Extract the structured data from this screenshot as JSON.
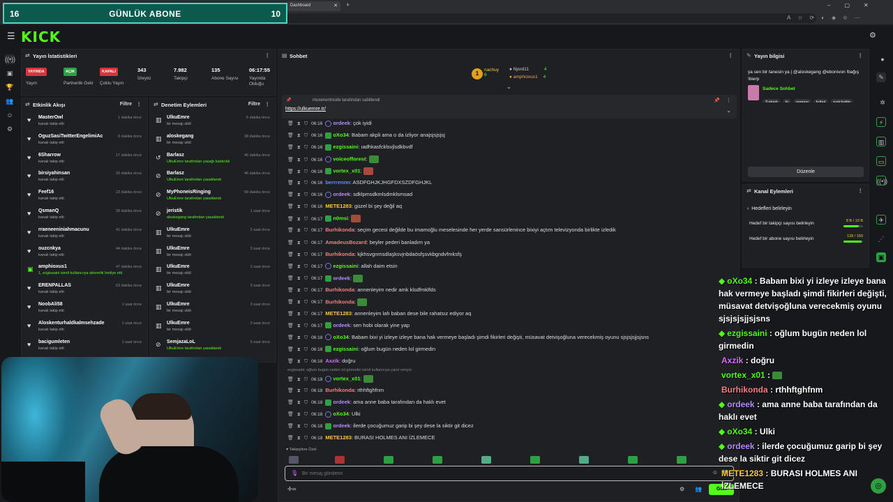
{
  "browser": {
    "tab_title": "Dashboard"
  },
  "subgoal": {
    "left": "16",
    "title": "GÜNLÜK ABONE",
    "right": "10"
  },
  "logo": "KICK",
  "stats": {
    "title": "Yayın İstatistikleri",
    "items": [
      {
        "pill": "YAYINDA",
        "label": "Yayın",
        "color": "#d9343c"
      },
      {
        "pill": "AÇIK",
        "label": "Partnerlik Gelir",
        "color": "#2ea043"
      },
      {
        "pill": "KAPALI",
        "label": "Çoklu Yayın",
        "color": "#d9343c"
      },
      {
        "value": "343",
        "label": "İzleyici"
      },
      {
        "value": "7.982",
        "label": "Takipçi"
      },
      {
        "value": "135",
        "label": "Abone Sayısı"
      },
      {
        "value": "06:17:55",
        "label": "Yayında Olduğu"
      }
    ]
  },
  "activity": {
    "title": "Etkinlik Akışı",
    "filter": "Filtre",
    "rows": [
      {
        "name": "MasterOwl",
        "sub": "kanalı takip etti",
        "time": "1 dakika önce"
      },
      {
        "name": "OguzSasiTwitterEngelimiAc",
        "sub": "kanalı takip etti",
        "time": "8 dakika önce"
      },
      {
        "name": "6Sharrow",
        "sub": "kanalı takip etti",
        "time": "17 dakika önce"
      },
      {
        "name": "birsiyahinsan",
        "sub": "kanalı takip etti",
        "time": "20 dakika önce"
      },
      {
        "name": "Feef16",
        "sub": "kanalı takip etti",
        "time": "23 dakika önce"
      },
      {
        "name": "QsmanQ",
        "sub": "kanalı takip etti",
        "time": "28 dakika önce"
      },
      {
        "name": "rraeneeniniahmacunu",
        "sub": "kanalı takip etti",
        "time": "41 dakika önce"
      },
      {
        "name": "ouzcnkya",
        "sub": "kanalı takip etti",
        "time": "44 dakika önce"
      },
      {
        "name": "amphioxus1",
        "sub": "1, ezgissaini isimli kullanıcıya abonelik hediye etti.",
        "time": "47 dakika önce"
      },
      {
        "name": "ERENPALLAS",
        "sub": "kanalı takip etti",
        "time": "53 dakika önce"
      },
      {
        "name": "NoobAli58",
        "sub": "kanalı takip etti",
        "time": "1 saat önce"
      },
      {
        "name": "Aloskenturhaldkalmsehzade",
        "sub": "kanalı takip etti",
        "time": "1 saat önce"
      },
      {
        "name": "bacigumleten",
        "sub": "kanalı takip etti",
        "time": "1 saat önce"
      }
    ]
  },
  "moderation": {
    "title": "Denetim Eylemleri",
    "filter": "Filtre",
    "rows": [
      {
        "name": "UlkuEmre",
        "sub": "bir mesajı sildi",
        "time": "6 dakika önce"
      },
      {
        "name": "aloskegang",
        "sub": "bir mesajı sildi",
        "time": "38 dakika önce"
      },
      {
        "name": "Barlasz",
        "sub": "UlkuEmre tarafından yasağı kaldırıldı",
        "time": "46 dakika önce"
      },
      {
        "name": "Barlasz",
        "sub": "UlkuEmre tarafından yasaklandı",
        "time": "46 dakika önce"
      },
      {
        "name": "MyPhoneisRinging",
        "sub": "UlkuEmre tarafından yasaklandı",
        "time": "58 dakika önce"
      },
      {
        "name": "jeristik",
        "sub": "aloskegang tarafından yasaklandı",
        "time": "1 saat önce"
      },
      {
        "name": "UlkuEmre",
        "sub": "bir mesajı sildi",
        "time": "2 saat önce"
      },
      {
        "name": "UlkuEmre",
        "sub": "bir mesajı sildi",
        "time": "3 saat önce"
      },
      {
        "name": "UlkuEmre",
        "sub": "bir mesajı sildi",
        "time": "3 saat önce"
      },
      {
        "name": "UlkuEmre",
        "sub": "bir mesajı sildi",
        "time": "3 saat önce"
      },
      {
        "name": "UlkuEmre",
        "sub": "bir mesajı sildi",
        "time": "3 saat önce"
      },
      {
        "name": "UlkuEmre",
        "sub": "bir mesajı sildi",
        "time": "3 saat önce"
      },
      {
        "name": "SemjazaLoL",
        "sub": "UlkuEmre tarafından yasaklandı",
        "time": "5 saat önce"
      }
    ]
  },
  "chat": {
    "title": "Sohbet",
    "top_gifters": [
      {
        "name": "nachuy",
        "count": "6"
      },
      {
        "name": "Njord11",
        "count": "4"
      },
      {
        "name": "amphioxus1",
        "count": "4"
      }
    ],
    "pinned_by": "muxenontriside tarafından sabitlendi",
    "pinned_link": "https://ulkuemre.tr/",
    "reply_hint": "ezgissaini: oğlum bugün neden lol girmedin isimli kullanıcıya yanıt veriyor",
    "followers_only": "Takipçilere Özel",
    "placeholder": "Bir mesaj gönderin",
    "send_label": "Gön",
    "messages": [
      {
        "time": "06:16",
        "user": "ordeek",
        "color": "#b48cff",
        "text": "çok iyidi"
      },
      {
        "time": "06:16",
        "user": "oXo34",
        "color": "#53fc18",
        "text": "Babam akpli ama o da izliyor anajsjsjsjsj"
      },
      {
        "time": "06:16",
        "user": "ezgissaini",
        "color": "#53fc18",
        "text": "ıadhkasfcklsvjlsdkbvdf"
      },
      {
        "time": "06:16",
        "user": "voiceofforest",
        "color": "#53fc18",
        "text": ""
      },
      {
        "time": "06:16",
        "user": "vortex_x01",
        "color": "#53fc18",
        "text": ""
      },
      {
        "time": "06:16",
        "user": "berrrennn",
        "color": "#5b8cff",
        "text": "ASDFGHJKJHGFDXSZDFGHJKL"
      },
      {
        "time": "06:16",
        "user": "ordeek",
        "color": "#b48cff",
        "text": "sdklpmsdkmlsdmklsmsad"
      },
      {
        "time": "06:16",
        "user": "METE1283",
        "color": "#f5c842",
        "text": "güzel bi şey değil aq"
      },
      {
        "time": "06:17",
        "user": "n0msi",
        "color": "#53fc18",
        "text": ""
      },
      {
        "time": "06:17",
        "user": "Burhikonda",
        "color": "#f08080",
        "text": "seçim gecesi değilde bu imamoğlu meselesinde her yerde sansürlenince bixiyi açtım televizyonda birlikte izledik"
      },
      {
        "time": "06:17",
        "user": "AmadeusBozard",
        "color": "#f08080",
        "text": "beyler pederi banladım ya"
      },
      {
        "time": "06:17",
        "user": "Burhikonda",
        "color": "#f08080",
        "text": "kjkhsvgnmsdlaşksvjnbdaösfşsvkbgndvfmksfş"
      },
      {
        "time": "06:17",
        "user": "ezgissaini",
        "color": "#53fc18",
        "text": "allah daim etsin"
      },
      {
        "time": "06:17",
        "user": "ordeek",
        "color": "#b48cff",
        "text": ""
      },
      {
        "time": "06:17",
        "user": "Burhikonda",
        "color": "#f08080",
        "text": "annenleyim nedir amk klsdfmklfds"
      },
      {
        "time": "06:17",
        "user": "Burhikonda",
        "color": "#f08080",
        "text": ""
      },
      {
        "time": "06:17",
        "user": "METE1283",
        "color": "#f5c842",
        "text": "annenleyim lafı baban dese bile rahatsız ediyor aq"
      },
      {
        "time": "06:17",
        "user": "ordeek",
        "color": "#b48cff",
        "text": "sen hobi olarak yine yap"
      },
      {
        "time": "06:18",
        "user": "oXo34",
        "color": "#53fc18",
        "text": "Babam bixi yi izleye izleye bana hak vermeye başladı şimdi fikirleri değişti, müsavat detvişoğluna verecekmiş oyunu sjsjsjsjjsjsns"
      },
      {
        "time": "06:18",
        "user": "ezgissaini",
        "color": "#53fc18",
        "text": "oğlum bugün neden lol girmedin"
      },
      {
        "time": "06:18",
        "user": "Axzik",
        "color": "#d96bff",
        "text": "doğru"
      },
      {
        "time": "06:18",
        "user": "vortex_x01",
        "color": "#53fc18",
        "text": ""
      },
      {
        "time": "06:18",
        "user": "Burhikonda",
        "color": "#f08080",
        "text": "rthhftghfnm"
      },
      {
        "time": "06:18",
        "user": "ordeek",
        "color": "#b48cff",
        "text": "ama anne baba tarafından da haklı evet"
      },
      {
        "time": "06:18",
        "user": "oXo34",
        "color": "#53fc18",
        "text": "Ulki"
      },
      {
        "time": "06:18",
        "user": "ordeek",
        "color": "#b48cff",
        "text": "ilerde çocuğumuz garip bi şey dese la siktir git dicez"
      },
      {
        "time": "06:18",
        "user": "METE1283",
        "color": "#f5c842",
        "text": "BURASI HOLMES ANI İZLEMECE"
      }
    ]
  },
  "stream_info": {
    "title": "Yayın bilgisi",
    "stream_title": "ya sen bir tanesin ya | @aloskegang @ebonivon !bağış !bierp",
    "category": "Sadece Sohbet",
    "tags": [
      "Turkish",
      "ki",
      "gaming",
      "futbol",
      "justchattin"
    ],
    "edit_label": "Düzenle"
  },
  "channel_actions": {
    "title": "Kanal Eylemleri",
    "goal_header": "Hedefleri belirleyin",
    "goals": [
      {
        "label": "Hedef bir takipçi sayısı belirleyin",
        "progress": "8 B / 10 B",
        "fraction": 0.8
      },
      {
        "label": "Hedef bir abone sayısı belirleyin",
        "progress": "139 / 150",
        "fraction": 0.93
      }
    ]
  },
  "overlay_chat": [
    {
      "user": "oXo34",
      "diamond": true,
      "color": "#53fc18",
      "text": "Babam bixi yi izleye izleye bana hak vermeye başladı şimdi fikirleri değişti, müsavat detvişoğluna verecekmiş oyunu sjsjsjsjjsjsns"
    },
    {
      "user": "ezgissaini",
      "diamond": true,
      "color": "#53fc18",
      "text": "oğlum bugün neden lol girmedin"
    },
    {
      "user": "Axzik",
      "diamond": false,
      "color": "#d96bff",
      "text": "doğru"
    },
    {
      "user": "vortex_x01",
      "diamond": false,
      "color": "#53fc18",
      "text": ""
    },
    {
      "user": "Burhikonda",
      "diamond": false,
      "color": "#f08080",
      "text": "rthhftghfnm"
    },
    {
      "user": "ordeek",
      "diamond": true,
      "color": "#b48cff",
      "text": "ama anne baba tarafından da haklı evet"
    },
    {
      "user": "oXo34",
      "diamond": true,
      "color": "#53fc18",
      "text": "Ulki"
    },
    {
      "user": "ordeek",
      "diamond": true,
      "color": "#b48cff",
      "text": "ilerde çocuğumuz garip bi şey dese la siktir git dicez"
    },
    {
      "user": "METE1283",
      "diamond": false,
      "color": "#f5c842",
      "text": "BURASI HOLMES ANI İZLEMECE"
    }
  ]
}
